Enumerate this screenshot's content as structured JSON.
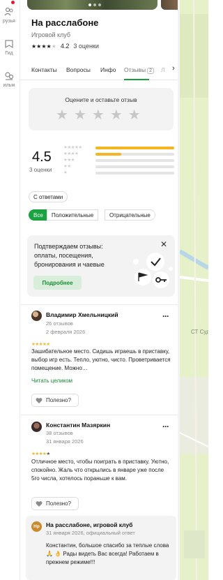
{
  "rail": {
    "items": [
      {
        "label": "рузья",
        "icon": "friends-icon"
      },
      {
        "label": "Гид",
        "icon": "guide-icon"
      },
      {
        "label": "ильм",
        "icon": "film-icon"
      }
    ]
  },
  "place": {
    "title": "На расслабоне",
    "category": "Игровой клуб",
    "rating_value": "4.2",
    "rating_stars": 4,
    "reviews_count": "3 оценки"
  },
  "tabs": [
    {
      "label": "Контакты",
      "active": false
    },
    {
      "label": "Вопросы",
      "active": false
    },
    {
      "label": "Инфо",
      "active": false
    },
    {
      "label": "Отзывы",
      "badge": "2",
      "active": true
    },
    {
      "label": "Л",
      "active": false
    }
  ],
  "rate_prompt": {
    "title": "Оцените и оставьте отзыв"
  },
  "summary": {
    "score": "4.5",
    "count": "3 оценки",
    "distribution": [
      {
        "stars": 5,
        "fraction": 1.0
      },
      {
        "stars": 4,
        "fraction": 0.33
      },
      {
        "stars": 3,
        "fraction": 0
      },
      {
        "stars": 2,
        "fraction": 0
      },
      {
        "stars": 1,
        "fraction": 0
      }
    ]
  },
  "filters": {
    "with_answers": "С ответами",
    "all": "Все",
    "positive": "Положительные",
    "negative": "Отрицательные"
  },
  "promo": {
    "text": "Подтверждаем отзывы: оплаты, посещения, бронирования и чаевые",
    "button": "Подробнее"
  },
  "reviews": [
    {
      "name": "Владимир Хмельницкий",
      "count": "26 отзывов",
      "date": "2 февраля 2026",
      "stars": 5,
      "text": "Зашибательное место. Сидишь играешь в приставку, выбор игр есть. Тепло, уютно, чисто. Проветривается помещение. Можно…",
      "read_more": "Читать целиком",
      "helpful": "Полезно?"
    },
    {
      "name": "Константин Мазяркин",
      "count": "38 отзывов",
      "date": "31 января 2026",
      "stars": 4,
      "text": "Отличное место, чтобы поиграть в приставку. Уютно, спокойно. Жаль что открылись в январе уже после 5го числа, хотелось пораньше к вам.",
      "helpful": "Полезно?"
    }
  ],
  "reply": {
    "avatar_text": "Нр",
    "name": "На расслабоне, игровой клуб",
    "meta": "31 января 2026, официальный ответ",
    "text": "Константин, большое спасибо за теплые слова 🙏 👌 Рады видеть Вас всегда! Работаем в прежнем режиме!!!"
  },
  "map": {
    "label": "СТ Суд"
  },
  "colors": {
    "accent": "#1aa340",
    "star": "#f5b623",
    "notification": "#e4162f"
  }
}
